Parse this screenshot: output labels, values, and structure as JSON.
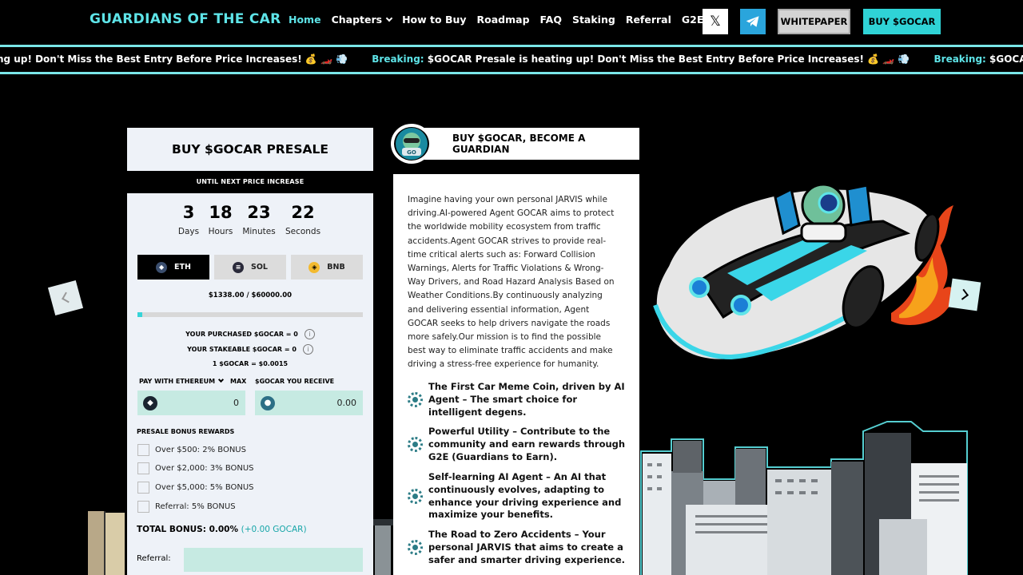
{
  "nav": {
    "brand": "GUARDIANS OF THE CAR",
    "items": [
      {
        "label": "Home",
        "active": true
      },
      {
        "label": "Chapters",
        "dropdown": true
      },
      {
        "label": "How to Buy"
      },
      {
        "label": "Roadmap"
      },
      {
        "label": "FAQ"
      },
      {
        "label": "Staking"
      },
      {
        "label": "Referral"
      },
      {
        "label": "G2E"
      }
    ],
    "x_glyph": "𝕏",
    "whitepaper": "WHITEPAPER",
    "buy": "BUY $GOCAR"
  },
  "ticker": {
    "partial_text": "ng up! Don't Miss the Best Entry Before Price Increases! 💰 🏎️ 💨",
    "lead": "Breaking:",
    "text": "$GOCAR Presale is heating up! Don't Miss the Best Entry Before Price Increases! 💰 🏎️ 💨"
  },
  "presale": {
    "title": "BUY $GOCAR PRESALE",
    "until": "UNTIL NEXT PRICE INCREASE",
    "countdown": [
      {
        "value": "3",
        "label": "Days"
      },
      {
        "value": "18",
        "label": "Hours"
      },
      {
        "value": "23",
        "label": "Minutes"
      },
      {
        "value": "22",
        "label": "Seconds"
      }
    ],
    "tabs": [
      {
        "label": "ETH",
        "icon": "ethereum-icon",
        "selected": true
      },
      {
        "label": "SOL",
        "icon": "solana-icon",
        "selected": false
      },
      {
        "label": "BNB",
        "icon": "bnb-icon",
        "selected": false
      }
    ],
    "raised": "$1338.00 / $60000.00",
    "progress": 0.0223,
    "purchased": "YOUR PURCHASED $GOCAR = 0",
    "stakeable": "YOUR STAKEABLE $GOCAR = 0",
    "rate": "1 $GOCAR = $0.0015",
    "pay_label": "PAY WITH ETHEREUM",
    "max_label": "MAX",
    "receive_label": "$GOCAR YOU RECEIVE",
    "pay_value": "0",
    "receive_value": "0.00",
    "bonus_title": "PRESALE BONUS REWARDS",
    "bonuses": [
      "Over $500: 2% BONUS",
      "Over $2,000: 3% BONUS",
      "Over $5,000: 5% BONUS",
      "Referral: 5% BONUS"
    ],
    "total_label": "TOTAL BONUS: 0.00%",
    "total_extra": "(+0.00 GOCAR)",
    "referral_label": "Referral:"
  },
  "about": {
    "heading": "BUY $GOCAR, BECOME A GUARDIAN",
    "text_lines": [
      "Imagine having your own personal JARVIS while",
      "driving.AI-powered Agent GOCAR aims to protect",
      "the worldwide mobility ecosystem from traffic",
      "accidents.Agent GOCAR strives to provide real-",
      "time critical alerts such as: Forward Collision",
      "Warnings, Alerts for Traffic Violations & Wrong-",
      "Way Drivers, and Road Hazard Analysis Based on",
      "Weather Conditions.By continuously analyzing",
      "and delivering essential information, Agent",
      "GOCAR seeks to help drivers navigate the roads",
      "more safely.Our mission is to find the possible",
      "best way to eliminate traffic accidents and make",
      "driving a stress-free experience for humanity."
    ],
    "features": [
      [
        "The First Car Meme Coin, driven by AI",
        "Agent – The smart choice for",
        "intelligent degens."
      ],
      [
        "Powerful Utility – Contribute to the",
        "community and earn rewards through",
        "G2E (Guardians to Earn)."
      ],
      [
        "Self-learning AI Agent – An AI that",
        "continuously evolves, adapting to",
        "enhance your driving experience and",
        "maximize your benefits."
      ],
      [
        "The Road to Zero Accidents – Your",
        "personal JARVIS that aims to create a",
        "safer and smarter driving experience."
      ]
    ],
    "avatar_text": "GO"
  },
  "colors": {
    "accent": "#5ee4e8",
    "button": "#2fd3d6",
    "input": "#c6eae2",
    "panel": "#eef2f8"
  }
}
